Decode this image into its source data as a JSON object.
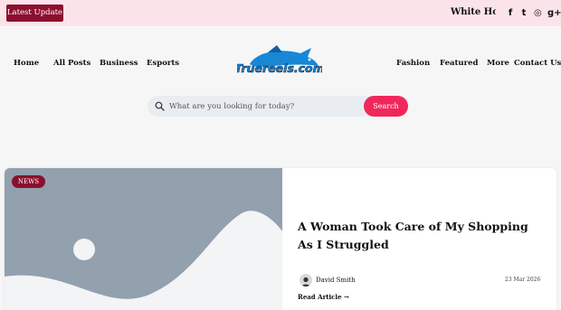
{
  "topbar": {
    "latest_label": "Latest Update",
    "ticker_text": "White House",
    "socials": [
      {
        "icon": "facebook-icon",
        "glyph": "f"
      },
      {
        "icon": "twitter-icon",
        "glyph": "t"
      },
      {
        "icon": "instagram-icon",
        "glyph": "◎"
      },
      {
        "icon": "google-plus-icon",
        "glyph": "g+"
      }
    ]
  },
  "nav": {
    "left": [
      "Home",
      "All Posts",
      "Business",
      "Esports"
    ],
    "right": [
      "Fashion",
      "Featured",
      "More",
      "Contact Us"
    ]
  },
  "logo": {
    "text": "Truereels.com"
  },
  "search": {
    "placeholder": "What are you looking for today?",
    "button_label": "Search"
  },
  "post": {
    "badge": "NEWS",
    "title": "A Woman Took Care of My Shopping As I Struggled",
    "author": "David Smith",
    "date": "23 Mar 2026",
    "read_more": "Read Article →"
  },
  "colors": {
    "topbar_bg": "#fbe3ea",
    "accent_dark": "#8c0f2e",
    "accent_pink": "#f0285a",
    "logo_blue": "#1787d6"
  }
}
